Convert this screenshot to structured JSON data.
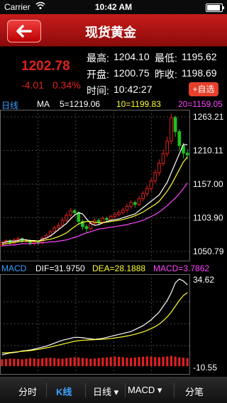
{
  "status_bar": {
    "carrier": "Carrier",
    "wifi_icon": "wifi-icon",
    "time": "10:42 AM"
  },
  "header": {
    "back_icon": "back-arrow-icon",
    "title": "现货黄金"
  },
  "quote": {
    "price": "1202.78",
    "change": "-4.01",
    "change_pct": "0.34%",
    "high_label": "最高:",
    "high": "1204.10",
    "low_label": "最低:",
    "low": "1195.62",
    "open_label": "开盘:",
    "open": "1200.75",
    "prev_close_label": "昨收:",
    "prev_close": "1198.69",
    "time_label": "时间:",
    "time": "10:42:27",
    "add_watch": "+自选",
    "colors": {
      "up": "#e02020",
      "down": "#20c020"
    }
  },
  "ma_legend": {
    "period_label": "日线",
    "ma_label": "MA",
    "ma5": "5=1219.06",
    "ma10": "10=1199.83",
    "ma20": "20=1159.05",
    "colors": {
      "ma5": "#ffffff",
      "ma10": "#ffff33",
      "ma20": "#ff44ff"
    }
  },
  "price_axis": [
    "1263.21",
    "1210.11",
    "1157.00",
    "1103.90",
    "1050.79"
  ],
  "macd_legend": {
    "title": "MACD",
    "dif": "DIF=31.9750",
    "dea": "DEA=28.1888",
    "macd": "MACD=3.7862"
  },
  "macd_axis": [
    "34.62",
    "-10.55"
  ],
  "tabs": [
    {
      "label": "分时",
      "active": false
    },
    {
      "label": "K线",
      "active": true
    },
    {
      "label": "日线 ▾",
      "active": false
    },
    {
      "label": "MACD ▾",
      "active": false
    },
    {
      "label": "分笔",
      "active": false
    }
  ],
  "chart_data": [
    {
      "type": "candlestick",
      "y_range": [
        1050.79,
        1263.21
      ],
      "series": [
        {
          "name": "5",
          "color": "#ffffff",
          "values": [
            1064,
            1066,
            1067,
            1067,
            1068,
            1070,
            1069,
            1068,
            1068,
            1067,
            1070,
            1072,
            1075,
            1080,
            1085,
            1090,
            1095,
            1102,
            1108,
            1112,
            1110,
            1102,
            1095,
            1092,
            1093,
            1096,
            1098,
            1100,
            1101,
            1102,
            1104,
            1106,
            1108,
            1110,
            1115,
            1120,
            1125,
            1130,
            1135,
            1140,
            1150,
            1160,
            1175,
            1190,
            1205,
            1220,
            1219
          ]
        },
        {
          "name": "10",
          "color": "#ffff33",
          "values": [
            1062,
            1063,
            1064,
            1065,
            1066,
            1067,
            1067,
            1067,
            1067,
            1067,
            1068,
            1069,
            1070,
            1072,
            1074,
            1077,
            1080,
            1085,
            1090,
            1094,
            1097,
            1098,
            1098,
            1097,
            1096,
            1096,
            1097,
            1098,
            1099,
            1100,
            1101,
            1103,
            1105,
            1107,
            1110,
            1113,
            1117,
            1121,
            1125,
            1130,
            1138,
            1146,
            1156,
            1168,
            1180,
            1192,
            1200
          ]
        },
        {
          "name": "20",
          "color": "#ff44ff",
          "values": [
            1060,
            1060,
            1061,
            1061,
            1062,
            1063,
            1063,
            1063,
            1064,
            1064,
            1065,
            1065,
            1066,
            1066,
            1067,
            1068,
            1069,
            1071,
            1073,
            1075,
            1078,
            1080,
            1082,
            1084,
            1086,
            1087,
            1088,
            1089,
            1090,
            1091,
            1092,
            1093,
            1095,
            1096,
            1098,
            1100,
            1103,
            1106,
            1109,
            1113,
            1118,
            1123,
            1129,
            1135,
            1142,
            1150,
            1159
          ]
        }
      ],
      "candles": [
        [
          1060,
          1065,
          1058,
          1068,
          "up"
        ],
        [
          1065,
          1068,
          1062,
          1070,
          "up"
        ],
        [
          1068,
          1064,
          1061,
          1070,
          "down"
        ],
        [
          1064,
          1069,
          1062,
          1072,
          "up"
        ],
        [
          1069,
          1071,
          1066,
          1074,
          "up"
        ],
        [
          1071,
          1067,
          1064,
          1073,
          "down"
        ],
        [
          1067,
          1068,
          1064,
          1071,
          "up"
        ],
        [
          1068,
          1063,
          1060,
          1070,
          "down"
        ],
        [
          1063,
          1066,
          1060,
          1068,
          "up"
        ],
        [
          1066,
          1064,
          1061,
          1069,
          "down"
        ],
        [
          1064,
          1072,
          1062,
          1074,
          "up"
        ],
        [
          1072,
          1076,
          1070,
          1079,
          "up"
        ],
        [
          1076,
          1082,
          1074,
          1085,
          "up"
        ],
        [
          1082,
          1088,
          1079,
          1091,
          "up"
        ],
        [
          1088,
          1092,
          1085,
          1096,
          "up"
        ],
        [
          1092,
          1100,
          1090,
          1104,
          "up"
        ],
        [
          1100,
          1108,
          1097,
          1112,
          "up"
        ],
        [
          1108,
          1115,
          1104,
          1119,
          "up"
        ],
        [
          1115,
          1112,
          1107,
          1118,
          "down"
        ],
        [
          1112,
          1098,
          1094,
          1114,
          "down"
        ],
        [
          1098,
          1090,
          1085,
          1101,
          "down"
        ],
        [
          1090,
          1087,
          1080,
          1093,
          "down"
        ],
        [
          1087,
          1095,
          1084,
          1098,
          "up"
        ],
        [
          1095,
          1100,
          1092,
          1104,
          "up"
        ],
        [
          1100,
          1097,
          1094,
          1103,
          "down"
        ],
        [
          1097,
          1103,
          1094,
          1106,
          "up"
        ],
        [
          1103,
          1101,
          1098,
          1106,
          "down"
        ],
        [
          1101,
          1106,
          1099,
          1109,
          "up"
        ],
        [
          1106,
          1109,
          1103,
          1112,
          "up"
        ],
        [
          1109,
          1112,
          1106,
          1116,
          "up"
        ],
        [
          1112,
          1116,
          1109,
          1120,
          "up"
        ],
        [
          1116,
          1122,
          1113,
          1126,
          "up"
        ],
        [
          1122,
          1128,
          1118,
          1132,
          "up"
        ],
        [
          1128,
          1125,
          1120,
          1131,
          "down"
        ],
        [
          1125,
          1134,
          1122,
          1138,
          "up"
        ],
        [
          1134,
          1142,
          1130,
          1146,
          "up"
        ],
        [
          1142,
          1150,
          1138,
          1155,
          "up"
        ],
        [
          1150,
          1162,
          1146,
          1166,
          "up"
        ],
        [
          1162,
          1175,
          1158,
          1180,
          "up"
        ],
        [
          1175,
          1190,
          1170,
          1196,
          "up"
        ],
        [
          1190,
          1205,
          1185,
          1212,
          "up"
        ],
        [
          1205,
          1225,
          1200,
          1232,
          "up"
        ],
        [
          1225,
          1262,
          1220,
          1268,
          "up"
        ],
        [
          1262,
          1240,
          1232,
          1265,
          "down"
        ],
        [
          1240,
          1218,
          1210,
          1244,
          "down"
        ],
        [
          1218,
          1206,
          1198,
          1222,
          "down"
        ],
        [
          1206,
          1203,
          1196,
          1212,
          "down"
        ]
      ]
    },
    {
      "type": "bar",
      "y_range": [
        -10.55,
        34.62
      ],
      "series": [
        {
          "name": "DIF",
          "color": "#ffffff",
          "values": [
            -4,
            -3.5,
            -3,
            -2.8,
            -2.5,
            -2,
            -1.8,
            -1.5,
            -1,
            -0.5,
            0,
            0.5,
            1.2,
            2,
            2.8,
            3.5,
            4,
            4.5,
            5,
            5,
            4.8,
            4.5,
            4.2,
            4,
            4.2,
            4.5,
            5,
            5.5,
            6,
            6.5,
            7,
            7.5,
            8,
            9,
            10,
            11,
            12.5,
            14,
            16,
            18,
            21,
            24,
            28,
            33,
            35,
            34,
            32
          ]
        },
        {
          "name": "DEA",
          "color": "#ffff33",
          "values": [
            -3,
            -3,
            -2.8,
            -2.6,
            -2.4,
            -2.2,
            -2,
            -1.8,
            -1.5,
            -1.2,
            -0.8,
            -0.4,
            0,
            0.5,
            1,
            1.5,
            2,
            2.5,
            3,
            3.3,
            3.5,
            3.6,
            3.7,
            3.8,
            3.9,
            4,
            4.2,
            4.4,
            4.7,
            5,
            5.3,
            5.7,
            6.1,
            6.6,
            7.2,
            7.8,
            8.6,
            9.5,
            10.5,
            11.8,
            13.5,
            15.5,
            18,
            21,
            24,
            26.5,
            28
          ]
        },
        {
          "name": "MACD",
          "color": "#e02020",
          "values": [
            3.2,
            3.4,
            3.6,
            3.5,
            3.4,
            3.2,
            3.5,
            3.8,
            3.6,
            3.5,
            3.7,
            3.9,
            4,
            3.8,
            3.6,
            3.5,
            3.8,
            4,
            4.2,
            4.1,
            3.9,
            3.7,
            3.5,
            3.6,
            3.8,
            4,
            4.1,
            4.3,
            4.5,
            4.4,
            4.2,
            4,
            3.9,
            4.1,
            4.3,
            4.5,
            4.6,
            4.5,
            4.3,
            4.2,
            4.4,
            4.6,
            4.8,
            4.5,
            4.2,
            4,
            3.8
          ]
        }
      ]
    }
  ]
}
